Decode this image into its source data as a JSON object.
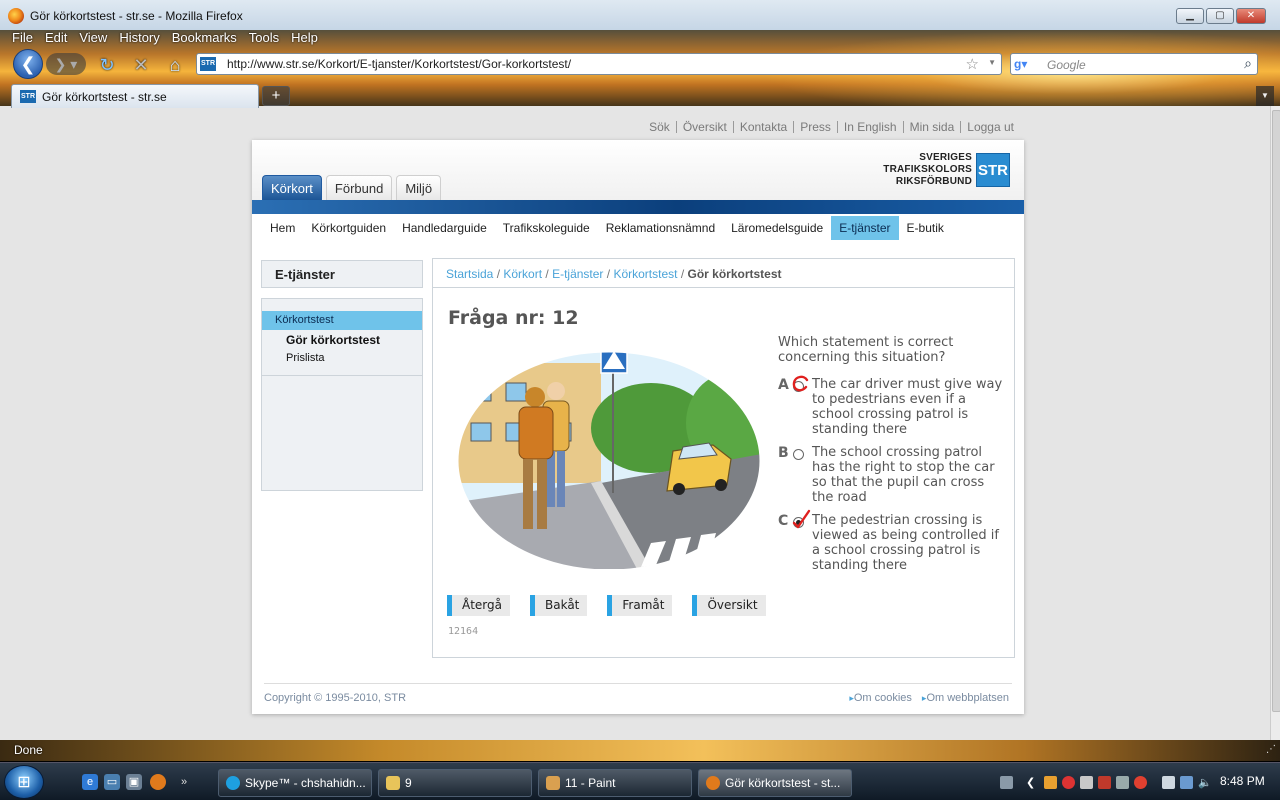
{
  "window": {
    "title": "Gör körkortstest - str.se - Mozilla Firefox"
  },
  "menu": [
    "File",
    "Edit",
    "View",
    "History",
    "Bookmarks",
    "Tools",
    "Help"
  ],
  "nav": {
    "url": "http://www.str.se/Korkort/E-tjanster/Korkortstest/Gor-korkortstest/",
    "search_placeholder": "Google",
    "site_badge": "STR"
  },
  "tab": {
    "label": "Gör körkortstest - str.se",
    "favicon": "STR"
  },
  "top_links": [
    "Sök",
    "Översikt",
    "Kontakta",
    "Press",
    "In English",
    "Min sida",
    "Logga ut"
  ],
  "logo": {
    "lines": [
      "SVERIGES",
      "TRAFIKSKOLORS",
      "RIKSFÖRBUND"
    ],
    "mark": "STR"
  },
  "main_tabs": [
    "Körkort",
    "Förbund",
    "Miljö"
  ],
  "subnav": [
    "Hem",
    "Körkortguiden",
    "Handledarguide",
    "Trafikskoleguide",
    "Reklamationsnämnd",
    "Läromedelsguide",
    "E-tjänster",
    "E-butik"
  ],
  "sidebar": {
    "heading": "E-tjänster",
    "items": [
      "Körkortstest",
      "Gör körkortstest",
      "Prislista"
    ]
  },
  "breadcrumb": [
    "Startsida",
    "Körkort",
    "E-tjänster",
    "Körkortstest",
    "Gör körkortstest"
  ],
  "question": {
    "title": "Fråga nr: 12",
    "text": "Which statement is correct concerning this situation?",
    "answers": [
      {
        "letter": "A",
        "text": "The car driver must give way to pedestrians even if a school crossing patrol is standing there",
        "checked": false,
        "mark": "circle"
      },
      {
        "letter": "B",
        "text": "The school crossing patrol has the right to stop the car so that the pupil can cross the road",
        "checked": false,
        "mark": ""
      },
      {
        "letter": "C",
        "text": "The pedestrian crossing is viewed as being controlled if a school crossing patrol is standing there",
        "checked": true,
        "mark": "check"
      }
    ],
    "buttons": [
      "Återgå",
      "Bakåt",
      "Framåt",
      "Översikt"
    ],
    "id": "12164"
  },
  "footer": {
    "copyright": "Copyright © 1995-2010, STR",
    "links": [
      "Om cookies",
      "Om webbplatsen"
    ]
  },
  "status": "Done",
  "taskbar": {
    "buttons": [
      "Skype™ - chshahidn...",
      "9",
      "11 - Paint",
      "Gör körkortstest - st..."
    ],
    "clock": "8:48 PM"
  },
  "colors": {
    "accent": "#1c5596",
    "highlight": "#6fc3ea",
    "link": "#4aa3d8",
    "mark": "#e0201e"
  }
}
